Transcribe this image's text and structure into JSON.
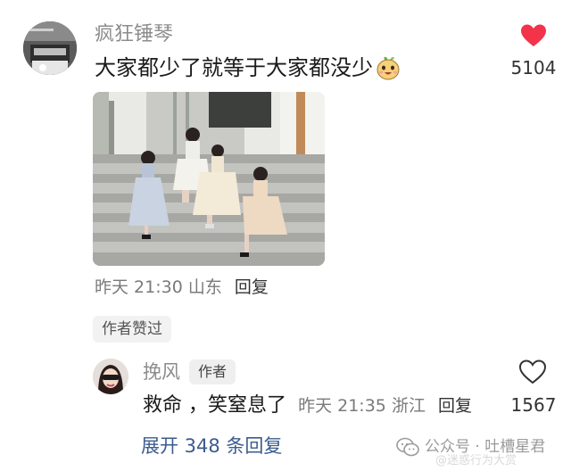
{
  "main_comment": {
    "username": "疯狂锤琴",
    "text": "大家都少了就等于大家都没少",
    "emoji": "smiling-face-emoji",
    "like_count": "5104",
    "liked": true,
    "time": "昨天 21:30",
    "location": "山东",
    "reply_label": "回复",
    "author_liked_label": "作者赞过"
  },
  "reply_comment": {
    "username": "挽风",
    "author_badge": "作者",
    "text": "救命 ，笑窒息了",
    "time": "昨天 21:35",
    "location": "浙江",
    "reply_label": "回复",
    "like_count": "1567",
    "liked": false
  },
  "expand_replies_label": "展开 348 条回复",
  "watermark": {
    "text": "公众号 · 吐槽星君",
    "faint_text": "@迷惑行为大赏"
  },
  "colors": {
    "heart_red": "#f2334a",
    "link_blue": "#3b5b8f",
    "meta_gray": "#7a7a7a"
  }
}
